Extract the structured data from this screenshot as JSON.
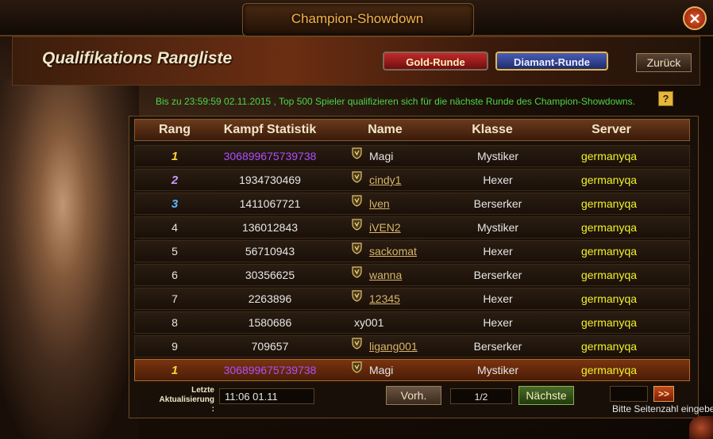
{
  "window": {
    "title": "Champion-Showdown"
  },
  "header": {
    "section_title": "Qualifikations Rangliste",
    "gold_tab": "Gold-Runde",
    "diamond_tab": "Diamant-Runde",
    "back_label": "Zurück"
  },
  "notice": "Bis zu 23:59:59 02.11.2015 , Top 500 Spieler qualifizieren sich für die nächste Runde des Champion-Showdowns.",
  "table": {
    "columns": [
      "Rang",
      "Kampf Statistik",
      "Name",
      "Klasse",
      "Server"
    ],
    "rows": [
      {
        "rank": "1",
        "stat": "306899675739738",
        "name": "Magi",
        "klasse": "Mystiker",
        "server": "germanyqa"
      },
      {
        "rank": "2",
        "stat": "1934730469",
        "name": "cindy1",
        "klasse": "Hexer",
        "server": "germanyqa"
      },
      {
        "rank": "3",
        "stat": "1411067721",
        "name": "lven",
        "klasse": "Berserker",
        "server": "germanyqa"
      },
      {
        "rank": "4",
        "stat": "136012843",
        "name": "iVEN2",
        "klasse": "Mystiker",
        "server": "germanyqa"
      },
      {
        "rank": "5",
        "stat": "56710943",
        "name": "sackomat",
        "klasse": "Hexer",
        "server": "germanyqa"
      },
      {
        "rank": "6",
        "stat": "30356625",
        "name": "wanna",
        "klasse": "Berserker",
        "server": "germanyqa"
      },
      {
        "rank": "7",
        "stat": "2263896",
        "name": "12345",
        "klasse": "Hexer",
        "server": "germanyqa"
      },
      {
        "rank": "8",
        "stat": "1580686",
        "name": "xy001",
        "klasse": "Hexer",
        "server": "germanyqa"
      },
      {
        "rank": "9",
        "stat": "709657",
        "name": "ligang001",
        "klasse": "Berserker",
        "server": "germanyqa"
      }
    ],
    "own_row": {
      "rank": "1",
      "stat": "306899675739738",
      "name": "Magi",
      "klasse": "Mystiker",
      "server": "germanyqa"
    }
  },
  "footer": {
    "last_update_label_1": "Letzte",
    "last_update_label_2": "Aktualisierung :",
    "last_update_value": "11:06 01.11",
    "prev_label": "Vorh.",
    "page": "1/2",
    "next_label": "Nächste",
    "go_label": ">>",
    "hint": "Bitte Seitenzahl eingeben"
  },
  "colors": {
    "accent_gold": "#f3b34a",
    "notice_green": "#4ad64a",
    "server_yellow": "#f2f229",
    "stat_purple": "#b04dff"
  },
  "icons": {
    "close": "close-icon",
    "help": "help-icon",
    "rank_shield": "shield-icon",
    "go": "double-chevron-right-icon"
  }
}
